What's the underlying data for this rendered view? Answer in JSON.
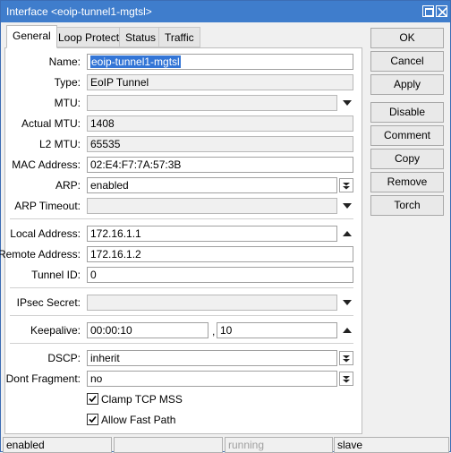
{
  "window": {
    "title": "Interface <eoip-tunnel1-mgtsl>"
  },
  "tabs": [
    {
      "label": "General",
      "active": true
    },
    {
      "label": "Loop Protect",
      "active": false
    },
    {
      "label": "Status",
      "active": false
    },
    {
      "label": "Traffic",
      "active": false
    }
  ],
  "form": {
    "name": {
      "label": "Name:",
      "value": "eoip-tunnel1-mgtsl"
    },
    "type": {
      "label": "Type:",
      "value": "EoIP Tunnel"
    },
    "mtu": {
      "label": "MTU:",
      "value": ""
    },
    "actual_mtu": {
      "label": "Actual MTU:",
      "value": "1408"
    },
    "l2_mtu": {
      "label": "L2 MTU:",
      "value": "65535"
    },
    "mac_address": {
      "label": "MAC Address:",
      "value": "02:E4:F7:7A:57:3B"
    },
    "arp": {
      "label": "ARP:",
      "value": "enabled"
    },
    "arp_timeout": {
      "label": "ARP Timeout:",
      "value": ""
    },
    "local_address": {
      "label": "Local Address:",
      "value": "172.16.1.1"
    },
    "remote_address": {
      "label": "Remote Address:",
      "value": "172.16.1.2"
    },
    "tunnel_id": {
      "label": "Tunnel ID:",
      "value": "0"
    },
    "ipsec_secret": {
      "label": "IPsec Secret:",
      "value": ""
    },
    "keepalive": {
      "label": "Keepalive:",
      "interval": "00:00:10",
      "separator": ",",
      "retries": "10"
    },
    "dscp": {
      "label": "DSCP:",
      "value": "inherit"
    },
    "dont_fragment": {
      "label": "Dont Fragment:",
      "value": "no"
    },
    "clamp_tcp_mss": {
      "label": "Clamp TCP MSS",
      "checked": true
    },
    "allow_fast_path": {
      "label": "Allow Fast Path",
      "checked": true
    }
  },
  "buttons": {
    "ok": "OK",
    "cancel": "Cancel",
    "apply": "Apply",
    "disable": "Disable",
    "comment": "Comment",
    "copy": "Copy",
    "remove": "Remove",
    "torch": "Torch"
  },
  "statusbar": {
    "state": "enabled",
    "empty": "",
    "running": "running",
    "role": "slave"
  },
  "colors": {
    "titlebar": "#3f7dcc",
    "selection": "#3375d6",
    "disabled_text": "#a0a0a0"
  }
}
